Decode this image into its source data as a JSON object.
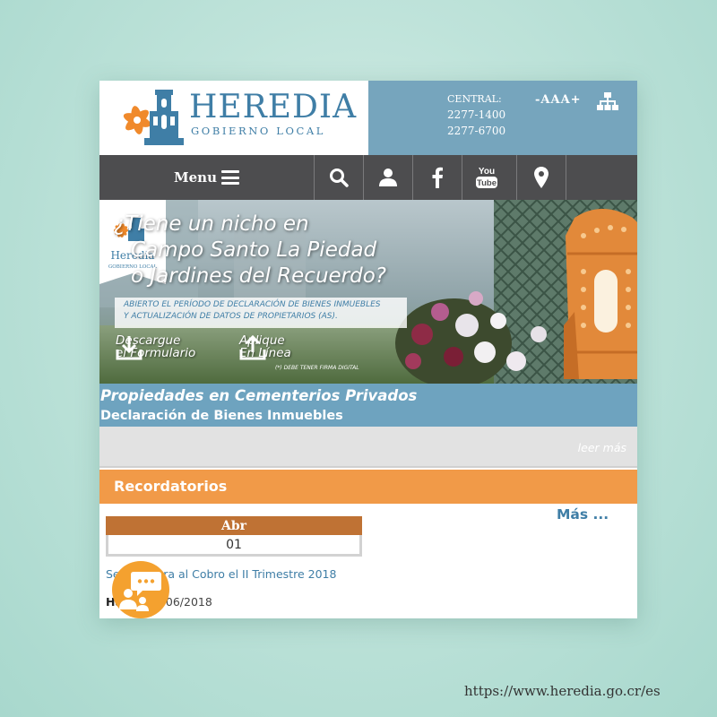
{
  "header": {
    "logo_title": "HEREDIA",
    "logo_subtitle": "GOBIERNO LOCAL",
    "central_label": "CENTRAL:",
    "phones": [
      "2277-1400",
      "2277-6700"
    ],
    "font_size_control": "-AAA+"
  },
  "nav": {
    "menu_label": "Menu",
    "icons": [
      "search-icon",
      "user-icon",
      "facebook-icon",
      "youtube-icon",
      "location-pin-icon"
    ],
    "youtube_top": "You",
    "youtube_bottom": "Tube"
  },
  "banner": {
    "headline": [
      "¿Tiene un nicho en",
      "Campo Santo La Piedad",
      "o Jardines del Recuerdo?"
    ],
    "notice": [
      "ABIERTO EL PERÍODO DE DECLARACIÓN DE BIENES INMUEBLES",
      "Y ACTUALIZACIÓN DE DATOS DE PROPIETARIOS (AS)."
    ],
    "download": [
      "Descargue",
      "el Formulario"
    ],
    "apply": [
      "Aplique",
      "En Línea"
    ],
    "note": "(*) DEBE TENER FIRMA DIGITAL",
    "badge_label": "Heredia",
    "badge_sublabel": "GOBIERNO LOCAL"
  },
  "caption": {
    "title": "Propiedades en Cementerios Privados",
    "subtitle": "Declaración de Bienes Inmuebles",
    "read_more": "leer más"
  },
  "reminders": {
    "title": "Recordatorios",
    "more": "Más ...",
    "month": "Abr",
    "day": "01",
    "item": "Se Pone en Cobro el II Trimestre 2018",
    "item_visible": "Se           tra al Cobro el II Trimestre 2018",
    "meta_label": "Ha",
    "meta_date": "06/2018"
  },
  "footer": {
    "url": "https://www.heredia.go.cr/es"
  },
  "colors": {
    "primary_blue": "#3f7ea6",
    "header_blue": "#76a5bd",
    "nav_gray": "#4d4d4f",
    "orange": "#f19a48",
    "date_brown": "#bf7234"
  }
}
